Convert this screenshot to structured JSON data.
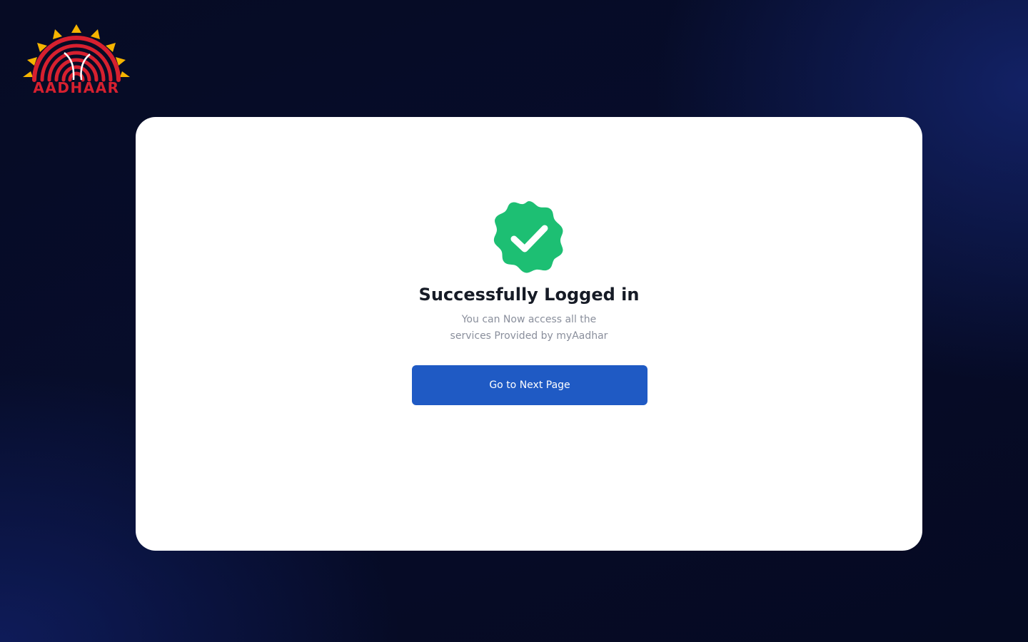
{
  "brand": {
    "logo_text": "AADHAAR",
    "logo_icon": "aadhaar-sun-fingerprint-icon",
    "colors": {
      "sun": "#f5b400",
      "fingerprint": "#d7202f"
    }
  },
  "card": {
    "success_icon": "verified-check-badge-icon",
    "title": "Successfully Logged in",
    "subtitle_line1": "You can Now access all the",
    "subtitle_line2": "services Provided by myAadhar",
    "button_label": "Go to Next Page"
  },
  "colors": {
    "background": "#060b24",
    "card": "#ffffff",
    "success": "#1dbf73",
    "button": "#1f5ac4",
    "title": "#161b26",
    "subtitle": "#8a8f9c"
  }
}
